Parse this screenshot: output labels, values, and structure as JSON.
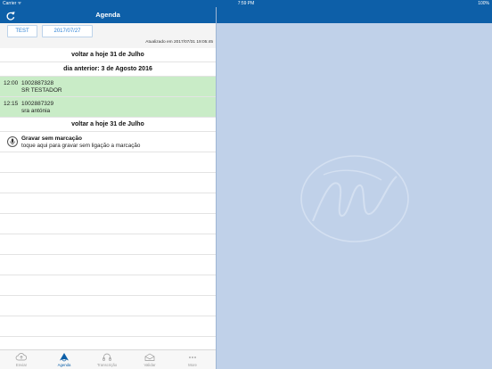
{
  "status_bar": {
    "carrier": "Carrier ᯤ",
    "time": "7:59 PM",
    "battery": "100%"
  },
  "navbar": {
    "title": "Agenda",
    "refresh_icon": "refresh-icon"
  },
  "toolbar": {
    "test_label": "TEST",
    "date_label": "2017/07/27",
    "updated_text": "Atualizado em 2017/07/31 19:05:45"
  },
  "list": {
    "back_today_top": "voltar a hoje 31 de Julho",
    "previous_day": "dia anterior: 3 de Agosto 2016",
    "appointments": [
      {
        "time": "12:00",
        "code": "1002887328",
        "name": "SR TESTADOR"
      },
      {
        "time": "12:15",
        "code": "1002887329",
        "name": "sra antónia"
      }
    ],
    "back_today_bottom": "voltar a hoje 31 de Julho",
    "record": {
      "title": "Gravar sem marcação",
      "subtitle": "toque aqui para gravar sem ligação a marcação",
      "icon": "microphone-icon"
    }
  },
  "tabs": [
    {
      "label": "Enviar",
      "icon": "cloud-upload-icon",
      "active": false
    },
    {
      "label": "Agenda",
      "icon": "calendar-icon",
      "active": true
    },
    {
      "label": "Transcrição",
      "icon": "headphones-icon",
      "active": false
    },
    {
      "label": "Validar",
      "icon": "inbox-icon",
      "active": false
    },
    {
      "label": "More",
      "icon": "more-icon",
      "active": false
    }
  ],
  "colors": {
    "brand": "#0d5fa8",
    "appointment_bg": "#c9ecc7",
    "right_bg": "#c0d1e9"
  }
}
